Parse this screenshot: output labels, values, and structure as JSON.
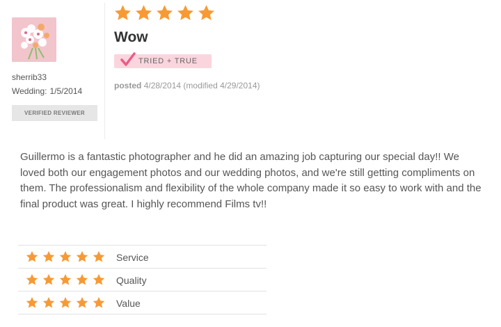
{
  "reviewer": {
    "username": "sherrib33",
    "wedding_label": "Wedding:",
    "wedding_date": "1/5/2014",
    "badge": "VERIFIED REVIEWER",
    "avatar_icon": "flower-bouquet-avatar"
  },
  "review": {
    "rating": 5,
    "max_rating": 5,
    "title": "Wow",
    "tried_badge": "TRIED + TRUE",
    "posted_label": "posted",
    "posted_date": "4/28/2014",
    "modified": "(modified 4/29/2014)",
    "body": "Guillermo is a fantastic photographer and he did an amazing job capturing our special day!! We loved both our engagement photos and our wedding photos, and we're still getting compliments on them. The professionalism and flexibility of the whole company made it so easy to work with and the final product was great. I highly recommend Films tv!!"
  },
  "sub_ratings": [
    {
      "label": "Service",
      "rating": 5
    },
    {
      "label": "Quality",
      "rating": 5
    },
    {
      "label": "Value",
      "rating": 5
    }
  ],
  "colors": {
    "star": "#f79a35",
    "badge_pink": "#fbd5de",
    "check_pink": "#ec5b86"
  }
}
